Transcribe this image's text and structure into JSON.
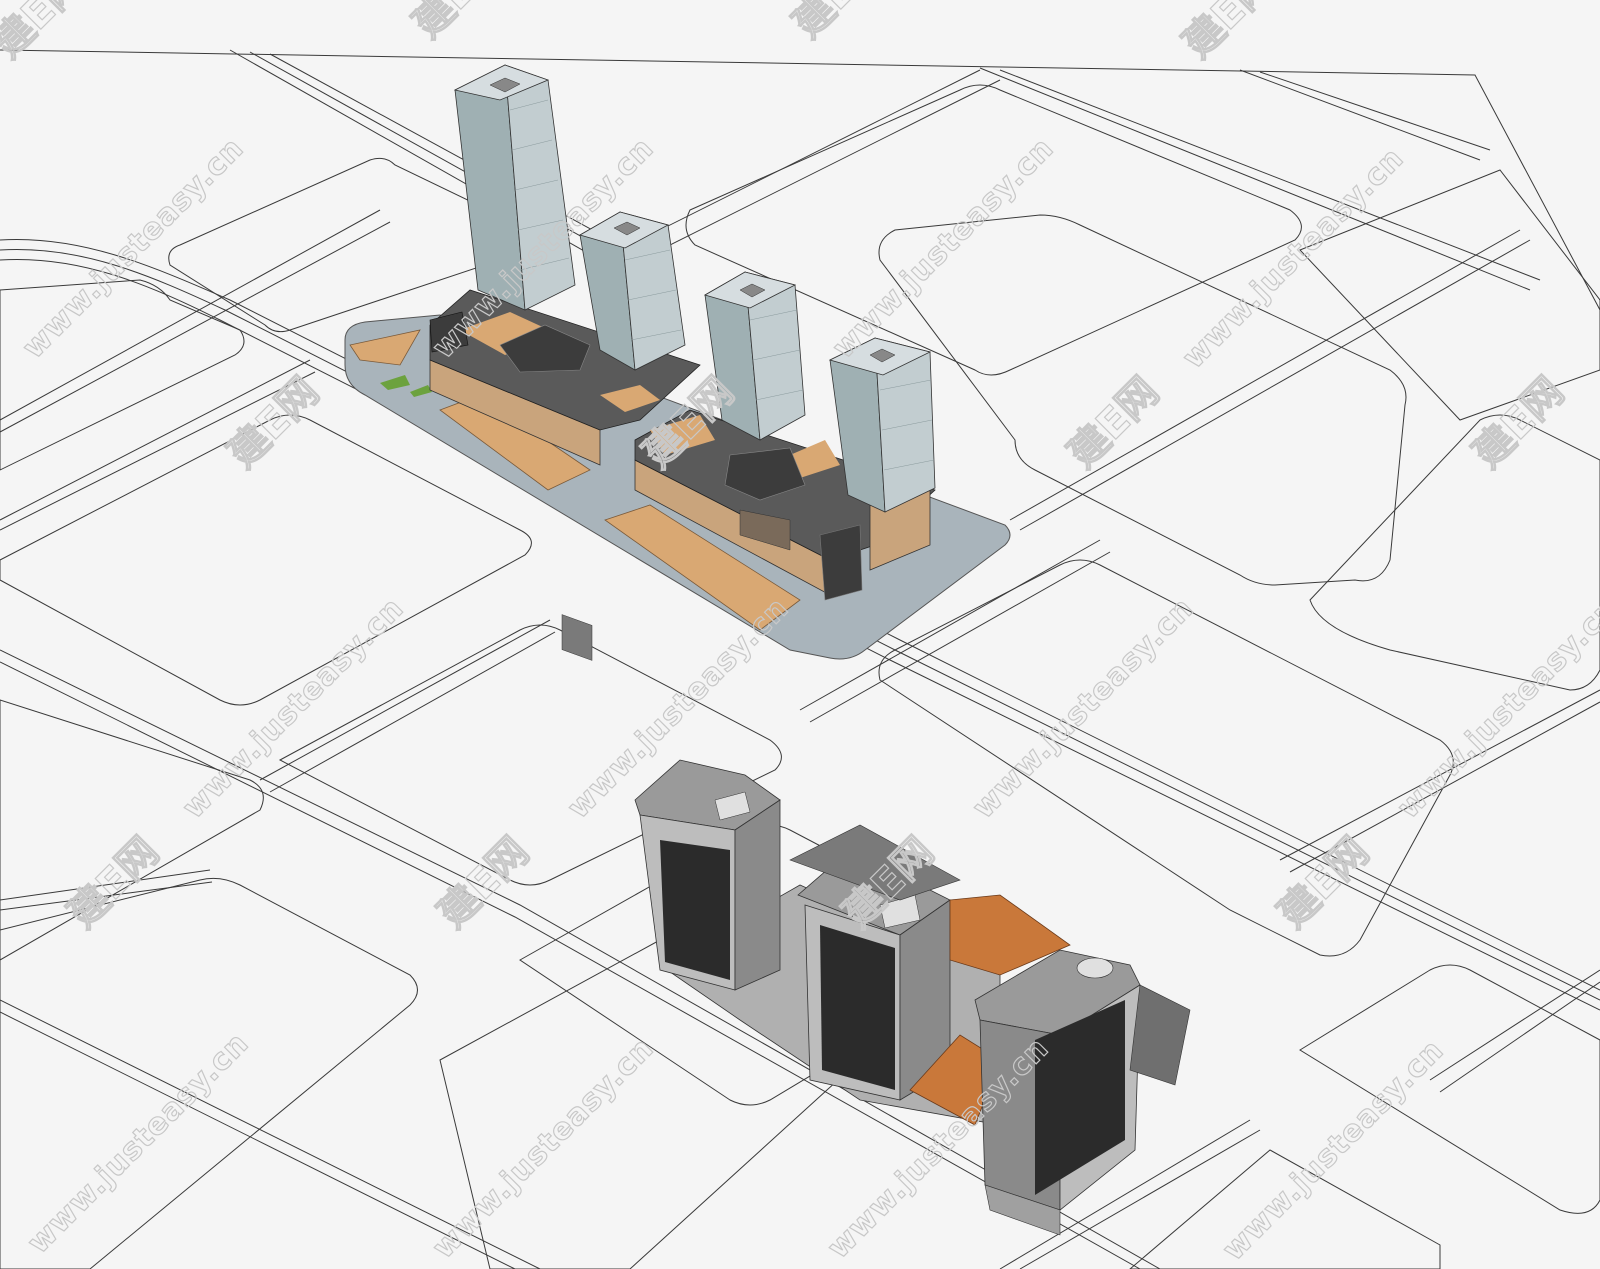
{
  "scene": {
    "background": "#f5f5f5",
    "road_color": "#3a3a3a",
    "plaza_color": "#a9b4bb",
    "wood_color": "#d9a873",
    "glass_color": "#b4c1c4",
    "podium_color": "#c9a47c",
    "tower_gray": "#a2a2a2"
  },
  "watermarks": {
    "domain_text": "www.justeasy.cn",
    "brand_text": "建E网"
  }
}
